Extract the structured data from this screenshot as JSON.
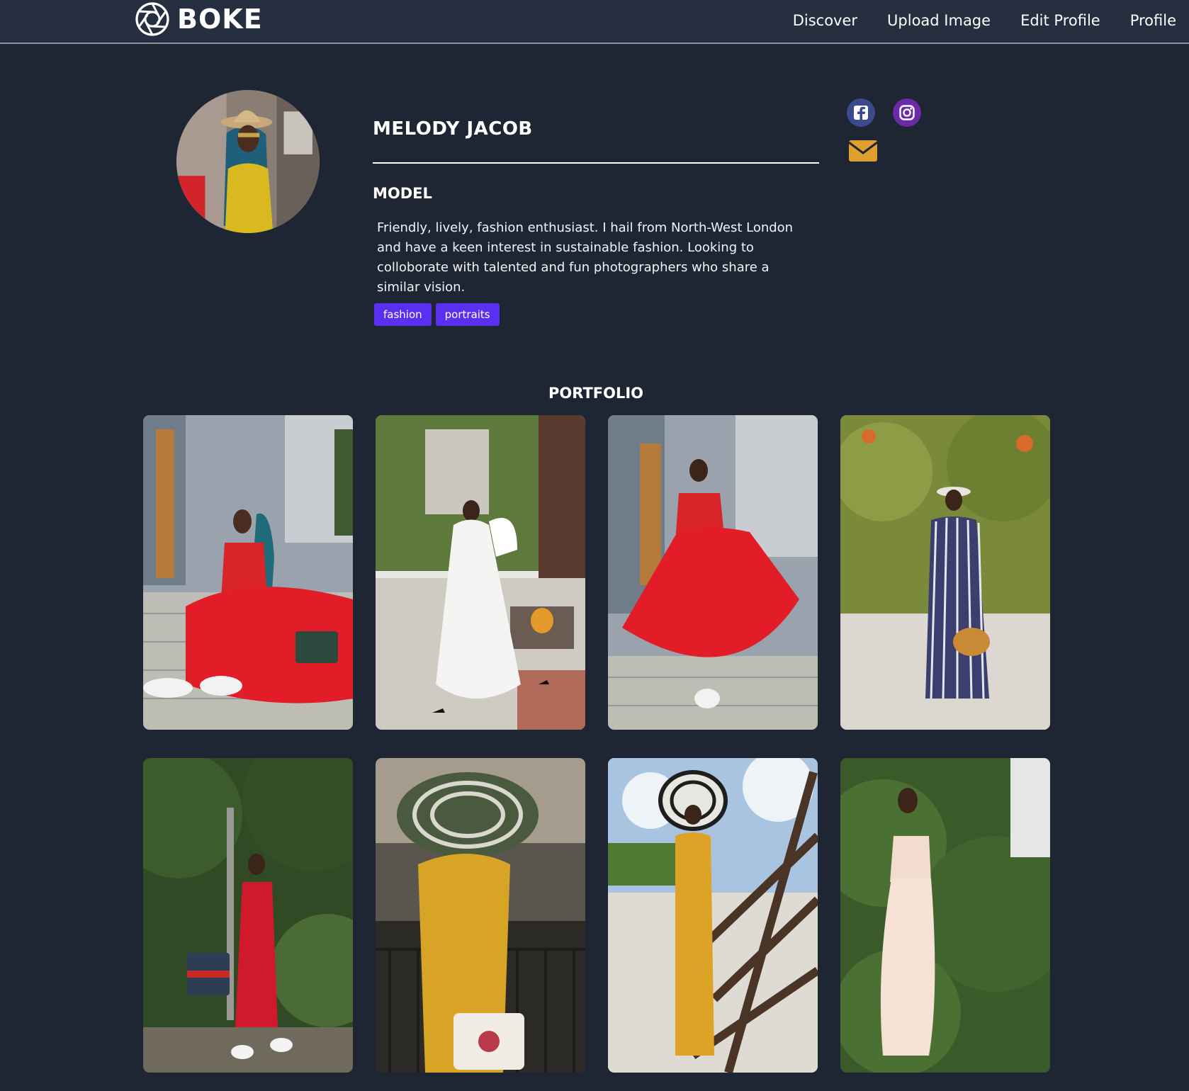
{
  "nav": {
    "brand": "BOKE",
    "brand_icon": "aperture-icon",
    "links": [
      "Discover",
      "Upload Image",
      "Edit Profile",
      "Profile"
    ]
  },
  "profile": {
    "name": "MELODY JACOB",
    "role": "MODEL",
    "bio": "Friendly, lively, fashion enthusiast. I hail from North-West London and have a keen interest in sustainable fashion. Looking to colloborate with talented and fun photographers who share a similar vision.",
    "tags": [
      "fashion",
      "portraits"
    ],
    "social": [
      {
        "name": "facebook-icon",
        "color": "#3b4a8c"
      },
      {
        "name": "instagram-icon",
        "color": "#6b2aa8"
      },
      {
        "name": "email-icon",
        "color": "#e0a030"
      }
    ]
  },
  "portfolio": {
    "title": "PORTFOLIO",
    "photos": [
      {
        "subject": "woman in red tulle dress sitting on stone steps"
      },
      {
        "subject": "woman in white dress walking on paved street"
      },
      {
        "subject": "woman in red tulle dress standing on steps"
      },
      {
        "subject": "woman in striped maxi dress with woven bag"
      },
      {
        "subject": "woman in red slip dress among greenery"
      },
      {
        "subject": "woman in large striped sun hat and yellow outfit"
      },
      {
        "subject": "woman in yellow jumpsuit climbing metal structure"
      },
      {
        "subject": "woman in cream strapless gown by ivy wall"
      }
    ]
  },
  "colors": {
    "background": "#1e2633",
    "nav_background": "#252f3f",
    "tag": "#5b2ff0"
  }
}
